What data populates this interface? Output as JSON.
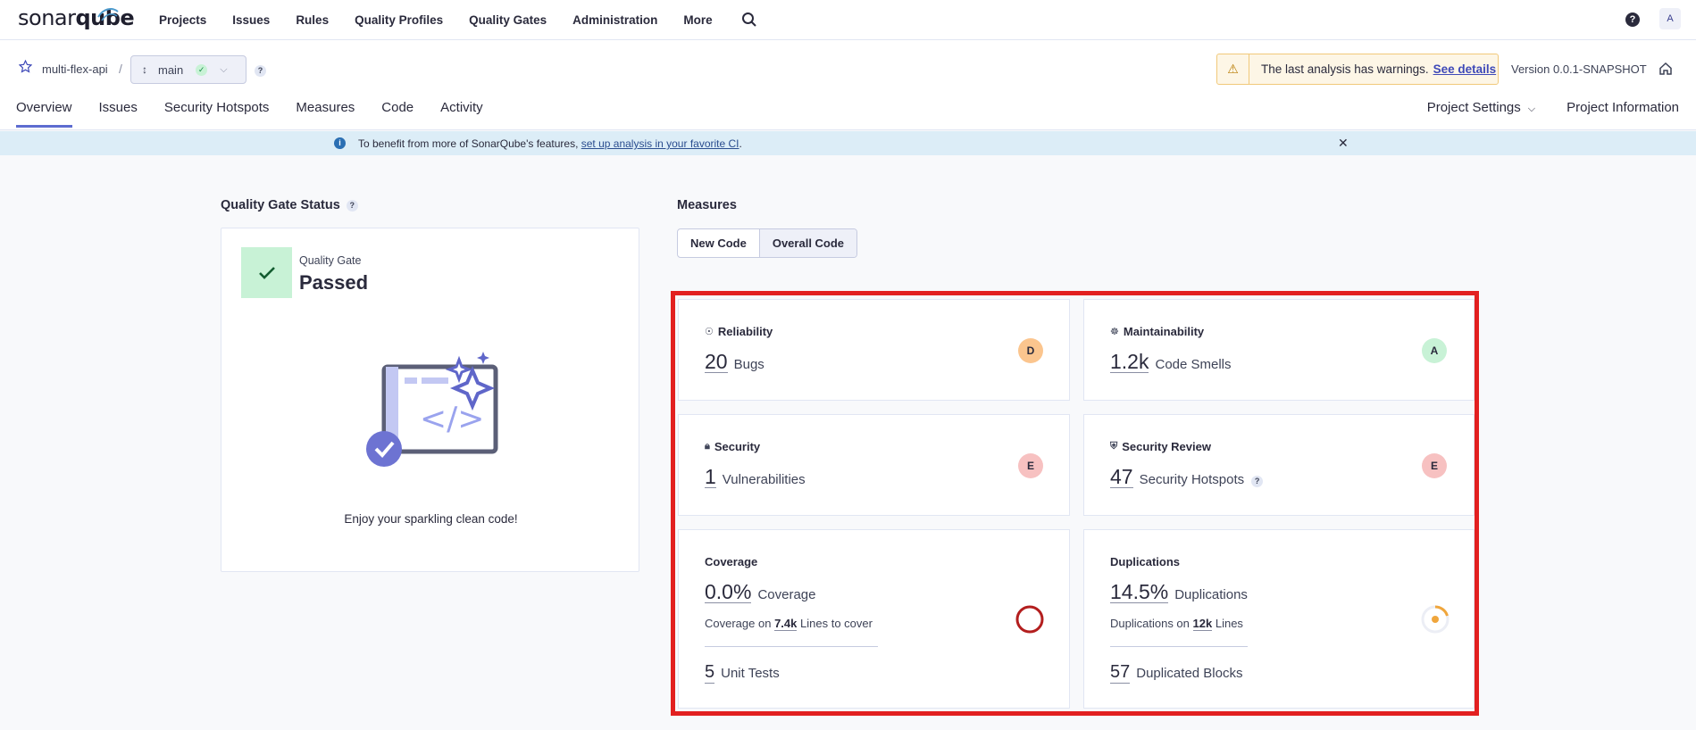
{
  "topnav": {
    "logo": {
      "light": "sonar",
      "bold": "qube"
    },
    "links": [
      "Projects",
      "Issues",
      "Rules",
      "Quality Profiles",
      "Quality Gates",
      "Administration",
      "More"
    ],
    "help_label": "?",
    "avatar_letter": "A"
  },
  "project": {
    "name": "multi-flex-api",
    "separator": "/",
    "branch": "main",
    "branch_help": "?",
    "warning_text": "The last analysis has warnings.",
    "warning_link": "See details",
    "version": "Version 0.0.1-SNAPSHOT",
    "tabs": [
      "Overview",
      "Issues",
      "Security Hotspots",
      "Measures",
      "Code",
      "Activity"
    ],
    "right_tabs": {
      "settings": "Project Settings",
      "information": "Project Information"
    }
  },
  "banner": {
    "text_before": "To benefit from more of SonarQube's features, ",
    "link": "set up analysis in your favorite CI",
    "text_after": "."
  },
  "quality_gate": {
    "title": "Quality Gate Status",
    "help": "?",
    "label": "Quality Gate",
    "status": "Passed",
    "message": "Enjoy your sparkling clean code!"
  },
  "measures": {
    "title": "Measures",
    "toggle": {
      "new": "New Code",
      "overall": "Overall Code",
      "selected": "Overall Code"
    },
    "reliability": {
      "label": "Reliability",
      "value": "20",
      "unit": "Bugs",
      "rating": "D"
    },
    "maintainability": {
      "label": "Maintainability",
      "value": "1.2k",
      "unit": "Code Smells",
      "rating": "A"
    },
    "security": {
      "label": "Security",
      "value": "1",
      "unit": "Vulnerabilities",
      "rating": "E"
    },
    "security_review": {
      "label": "Security Review",
      "value": "47",
      "unit": "Security Hotspots",
      "rating": "E",
      "help": "?"
    },
    "coverage": {
      "label": "Coverage",
      "value": "0.0%",
      "unit": "Coverage",
      "sub_prefix": "Coverage on",
      "sub_value": "7.4k",
      "sub_suffix": "Lines to cover",
      "tests_value": "5",
      "tests_unit": "Unit Tests"
    },
    "duplications": {
      "label": "Duplications",
      "value": "14.5%",
      "unit": "Duplications",
      "sub_prefix": "Duplications on",
      "sub_value": "12k",
      "sub_suffix": "Lines",
      "blocks_value": "57",
      "blocks_unit": "Duplicated Blocks"
    }
  },
  "colors": {
    "accent": "#5d6cd0",
    "rating_A": "#c8f2d6",
    "rating_D": "#fbc58e",
    "rating_E": "#f7c1c1",
    "highlight_box": "#e22020",
    "coverage_ring": "#b31e1e",
    "duplication_ring": "#f0a63c"
  }
}
